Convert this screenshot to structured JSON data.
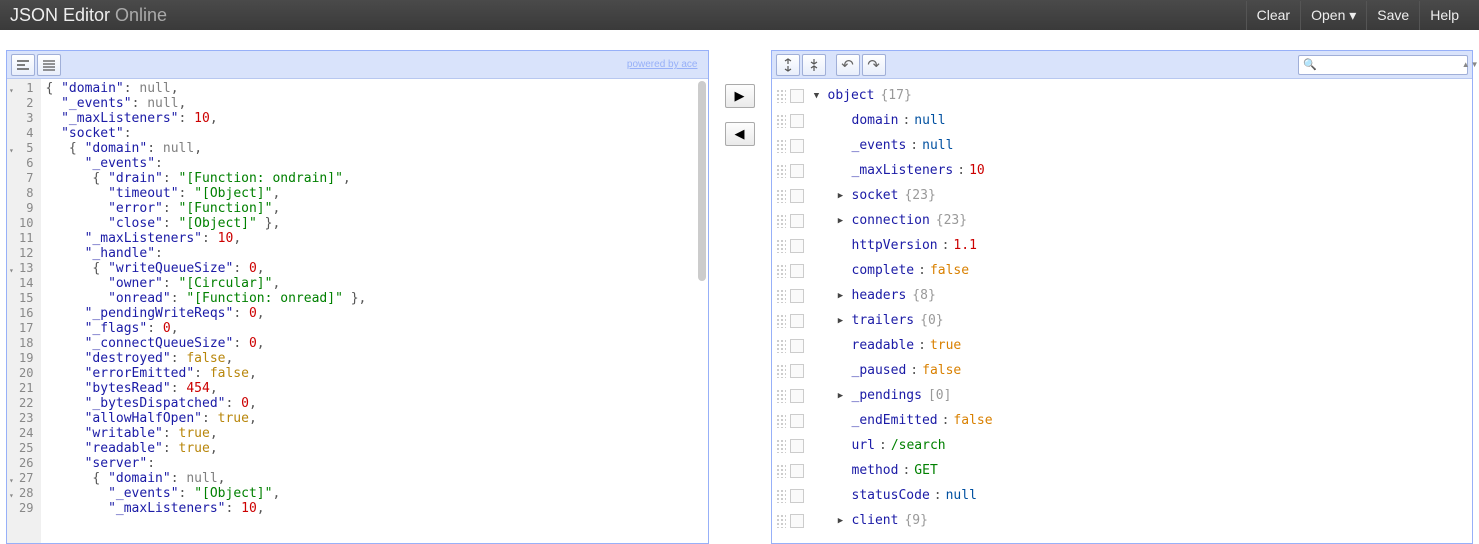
{
  "header": {
    "title_bold": "JSON Editor",
    "title_light": " Online",
    "menu": {
      "clear": "Clear",
      "open": "Open ▾",
      "save": "Save",
      "help": "Help"
    }
  },
  "left": {
    "powered": "powered by ace",
    "code_lines": [
      {
        "n": "1",
        "fold": true,
        "tokens": [
          {
            "t": "p",
            "v": "{ "
          },
          {
            "t": "k",
            "v": "\"domain\""
          },
          {
            "t": "p",
            "v": ": "
          },
          {
            "t": "nl",
            "v": "null"
          },
          {
            "t": "p",
            "v": ","
          }
        ]
      },
      {
        "n": "2",
        "tokens": [
          {
            "t": "p",
            "v": "  "
          },
          {
            "t": "k",
            "v": "\"_events\""
          },
          {
            "t": "p",
            "v": ": "
          },
          {
            "t": "nl",
            "v": "null"
          },
          {
            "t": "p",
            "v": ","
          }
        ]
      },
      {
        "n": "3",
        "tokens": [
          {
            "t": "p",
            "v": "  "
          },
          {
            "t": "k",
            "v": "\"_maxListeners\""
          },
          {
            "t": "p",
            "v": ": "
          },
          {
            "t": "n",
            "v": "10"
          },
          {
            "t": "p",
            "v": ","
          }
        ]
      },
      {
        "n": "4",
        "tokens": [
          {
            "t": "p",
            "v": "  "
          },
          {
            "t": "k",
            "v": "\"socket\""
          },
          {
            "t": "p",
            "v": ":"
          }
        ]
      },
      {
        "n": "5",
        "fold": true,
        "tokens": [
          {
            "t": "p",
            "v": "   { "
          },
          {
            "t": "k",
            "v": "\"domain\""
          },
          {
            "t": "p",
            "v": ": "
          },
          {
            "t": "nl",
            "v": "null"
          },
          {
            "t": "p",
            "v": ","
          }
        ]
      },
      {
        "n": "6",
        "tokens": [
          {
            "t": "p",
            "v": "     "
          },
          {
            "t": "k",
            "v": "\"_events\""
          },
          {
            "t": "p",
            "v": ":"
          }
        ]
      },
      {
        "n": "7",
        "tokens": [
          {
            "t": "p",
            "v": "      { "
          },
          {
            "t": "k",
            "v": "\"drain\""
          },
          {
            "t": "p",
            "v": ": "
          },
          {
            "t": "s",
            "v": "\"[Function: ondrain]\""
          },
          {
            "t": "p",
            "v": ","
          }
        ]
      },
      {
        "n": "8",
        "tokens": [
          {
            "t": "p",
            "v": "        "
          },
          {
            "t": "k",
            "v": "\"timeout\""
          },
          {
            "t": "p",
            "v": ": "
          },
          {
            "t": "s",
            "v": "\"[Object]\""
          },
          {
            "t": "p",
            "v": ","
          }
        ]
      },
      {
        "n": "9",
        "tokens": [
          {
            "t": "p",
            "v": "        "
          },
          {
            "t": "k",
            "v": "\"error\""
          },
          {
            "t": "p",
            "v": ": "
          },
          {
            "t": "s",
            "v": "\"[Function]\""
          },
          {
            "t": "p",
            "v": ","
          }
        ]
      },
      {
        "n": "10",
        "tokens": [
          {
            "t": "p",
            "v": "        "
          },
          {
            "t": "k",
            "v": "\"close\""
          },
          {
            "t": "p",
            "v": ": "
          },
          {
            "t": "s",
            "v": "\"[Object]\""
          },
          {
            "t": "p",
            "v": " },"
          }
        ]
      },
      {
        "n": "11",
        "tokens": [
          {
            "t": "p",
            "v": "     "
          },
          {
            "t": "k",
            "v": "\"_maxListeners\""
          },
          {
            "t": "p",
            "v": ": "
          },
          {
            "t": "n",
            "v": "10"
          },
          {
            "t": "p",
            "v": ","
          }
        ]
      },
      {
        "n": "12",
        "tokens": [
          {
            "t": "p",
            "v": "     "
          },
          {
            "t": "k",
            "v": "\"_handle\""
          },
          {
            "t": "p",
            "v": ":"
          }
        ]
      },
      {
        "n": "13",
        "fold": true,
        "tokens": [
          {
            "t": "p",
            "v": "      { "
          },
          {
            "t": "k",
            "v": "\"writeQueueSize\""
          },
          {
            "t": "p",
            "v": ": "
          },
          {
            "t": "n",
            "v": "0"
          },
          {
            "t": "p",
            "v": ","
          }
        ]
      },
      {
        "n": "14",
        "tokens": [
          {
            "t": "p",
            "v": "        "
          },
          {
            "t": "k",
            "v": "\"owner\""
          },
          {
            "t": "p",
            "v": ": "
          },
          {
            "t": "s",
            "v": "\"[Circular]\""
          },
          {
            "t": "p",
            "v": ","
          }
        ]
      },
      {
        "n": "15",
        "tokens": [
          {
            "t": "p",
            "v": "        "
          },
          {
            "t": "k",
            "v": "\"onread\""
          },
          {
            "t": "p",
            "v": ": "
          },
          {
            "t": "s",
            "v": "\"[Function: onread]\""
          },
          {
            "t": "p",
            "v": " },"
          }
        ]
      },
      {
        "n": "16",
        "tokens": [
          {
            "t": "p",
            "v": "     "
          },
          {
            "t": "k",
            "v": "\"_pendingWriteReqs\""
          },
          {
            "t": "p",
            "v": ": "
          },
          {
            "t": "n",
            "v": "0"
          },
          {
            "t": "p",
            "v": ","
          }
        ]
      },
      {
        "n": "17",
        "tokens": [
          {
            "t": "p",
            "v": "     "
          },
          {
            "t": "k",
            "v": "\"_flags\""
          },
          {
            "t": "p",
            "v": ": "
          },
          {
            "t": "n",
            "v": "0"
          },
          {
            "t": "p",
            "v": ","
          }
        ]
      },
      {
        "n": "18",
        "tokens": [
          {
            "t": "p",
            "v": "     "
          },
          {
            "t": "k",
            "v": "\"_connectQueueSize\""
          },
          {
            "t": "p",
            "v": ": "
          },
          {
            "t": "n",
            "v": "0"
          },
          {
            "t": "p",
            "v": ","
          }
        ]
      },
      {
        "n": "19",
        "tokens": [
          {
            "t": "p",
            "v": "     "
          },
          {
            "t": "k",
            "v": "\"destroyed\""
          },
          {
            "t": "p",
            "v": ": "
          },
          {
            "t": "b",
            "v": "false"
          },
          {
            "t": "p",
            "v": ","
          }
        ]
      },
      {
        "n": "20",
        "tokens": [
          {
            "t": "p",
            "v": "     "
          },
          {
            "t": "k",
            "v": "\"errorEmitted\""
          },
          {
            "t": "p",
            "v": ": "
          },
          {
            "t": "b",
            "v": "false"
          },
          {
            "t": "p",
            "v": ","
          }
        ]
      },
      {
        "n": "21",
        "tokens": [
          {
            "t": "p",
            "v": "     "
          },
          {
            "t": "k",
            "v": "\"bytesRead\""
          },
          {
            "t": "p",
            "v": ": "
          },
          {
            "t": "n",
            "v": "454"
          },
          {
            "t": "p",
            "v": ","
          }
        ]
      },
      {
        "n": "22",
        "tokens": [
          {
            "t": "p",
            "v": "     "
          },
          {
            "t": "k",
            "v": "\"_bytesDispatched\""
          },
          {
            "t": "p",
            "v": ": "
          },
          {
            "t": "n",
            "v": "0"
          },
          {
            "t": "p",
            "v": ","
          }
        ]
      },
      {
        "n": "23",
        "tokens": [
          {
            "t": "p",
            "v": "     "
          },
          {
            "t": "k",
            "v": "\"allowHalfOpen\""
          },
          {
            "t": "p",
            "v": ": "
          },
          {
            "t": "b",
            "v": "true"
          },
          {
            "t": "p",
            "v": ","
          }
        ]
      },
      {
        "n": "24",
        "tokens": [
          {
            "t": "p",
            "v": "     "
          },
          {
            "t": "k",
            "v": "\"writable\""
          },
          {
            "t": "p",
            "v": ": "
          },
          {
            "t": "b",
            "v": "true"
          },
          {
            "t": "p",
            "v": ","
          }
        ]
      },
      {
        "n": "25",
        "tokens": [
          {
            "t": "p",
            "v": "     "
          },
          {
            "t": "k",
            "v": "\"readable\""
          },
          {
            "t": "p",
            "v": ": "
          },
          {
            "t": "b",
            "v": "true"
          },
          {
            "t": "p",
            "v": ","
          }
        ]
      },
      {
        "n": "26",
        "tokens": [
          {
            "t": "p",
            "v": "     "
          },
          {
            "t": "k",
            "v": "\"server\""
          },
          {
            "t": "p",
            "v": ":"
          }
        ]
      },
      {
        "n": "27",
        "fold": true,
        "tokens": [
          {
            "t": "p",
            "v": "      { "
          },
          {
            "t": "k",
            "v": "\"domain\""
          },
          {
            "t": "p",
            "v": ": "
          },
          {
            "t": "nl",
            "v": "null"
          },
          {
            "t": "p",
            "v": ","
          }
        ]
      },
      {
        "n": "28",
        "fold": true,
        "tokens": [
          {
            "t": "p",
            "v": "        "
          },
          {
            "t": "k",
            "v": "\"_events\""
          },
          {
            "t": "p",
            "v": ": "
          },
          {
            "t": "s",
            "v": "\"[Object]\""
          },
          {
            "t": "p",
            "v": ","
          }
        ]
      },
      {
        "n": "29",
        "tokens": [
          {
            "t": "p",
            "v": "        "
          },
          {
            "t": "k",
            "v": "\"_maxListeners\""
          },
          {
            "t": "p",
            "v": ": "
          },
          {
            "t": "n",
            "v": "10"
          },
          {
            "t": "p",
            "v": ","
          }
        ]
      }
    ]
  },
  "right": {
    "tree": [
      {
        "indent": 0,
        "exp": "▼",
        "field": "object",
        "count": "{17}"
      },
      {
        "indent": 1,
        "exp": "",
        "field": "domain",
        "sep": ":",
        "vtype": "null",
        "val": "null"
      },
      {
        "indent": 1,
        "exp": "",
        "field": "_events",
        "sep": ":",
        "vtype": "null",
        "val": "null"
      },
      {
        "indent": 1,
        "exp": "",
        "field": "_maxListeners",
        "sep": ":",
        "vtype": "num",
        "val": "10"
      },
      {
        "indent": 1,
        "exp": "▶",
        "field": "socket",
        "count": "{23}"
      },
      {
        "indent": 1,
        "exp": "▶",
        "field": "connection",
        "count": "{23}"
      },
      {
        "indent": 1,
        "exp": "",
        "field": "httpVersion",
        "sep": ":",
        "vtype": "num",
        "val": "1.1"
      },
      {
        "indent": 1,
        "exp": "",
        "field": "complete",
        "sep": ":",
        "vtype": "bool",
        "val": "false"
      },
      {
        "indent": 1,
        "exp": "▶",
        "field": "headers",
        "count": "{8}"
      },
      {
        "indent": 1,
        "exp": "▶",
        "field": "trailers",
        "count": "{0}"
      },
      {
        "indent": 1,
        "exp": "",
        "field": "readable",
        "sep": ":",
        "vtype": "bool",
        "val": "true"
      },
      {
        "indent": 1,
        "exp": "",
        "field": "_paused",
        "sep": ":",
        "vtype": "bool",
        "val": "false"
      },
      {
        "indent": 1,
        "exp": "▶",
        "field": "_pendings",
        "count": "[0]"
      },
      {
        "indent": 1,
        "exp": "",
        "field": "_endEmitted",
        "sep": ":",
        "vtype": "bool",
        "val": "false"
      },
      {
        "indent": 1,
        "exp": "",
        "field": "url",
        "sep": ":",
        "vtype": "str",
        "val": "/search"
      },
      {
        "indent": 1,
        "exp": "",
        "field": "method",
        "sep": ":",
        "vtype": "str",
        "val": "GET"
      },
      {
        "indent": 1,
        "exp": "",
        "field": "statusCode",
        "sep": ":",
        "vtype": "null",
        "val": "null"
      },
      {
        "indent": 1,
        "exp": "▶",
        "field": "client",
        "count": "{9}"
      }
    ]
  },
  "icons": {
    "format": "≡",
    "compact": "≣",
    "expand_all": "⤢",
    "collapse_all": "⤡",
    "undo": "↶",
    "redo": "↷",
    "search": "🔍",
    "to_right": "▶",
    "to_left": "◀",
    "tri_up": "▲",
    "tri_down": "▼"
  }
}
